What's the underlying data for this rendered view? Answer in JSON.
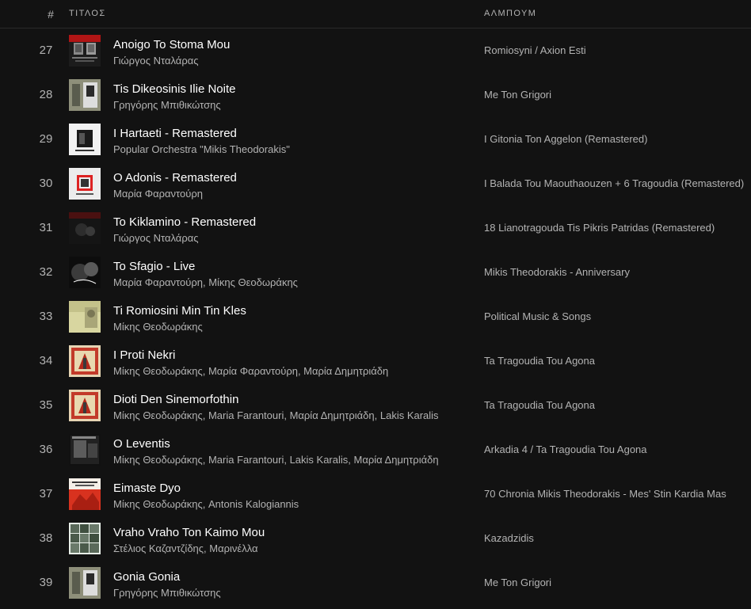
{
  "header": {
    "num": "#",
    "title": "ΤΙΤΛΟΣ",
    "album": "ΑΛΜΠΟΥΜ"
  },
  "tracks": [
    {
      "num": "27",
      "title": "Anoigo To Stoma Mou",
      "artist": "Γιώργος Νταλάρας",
      "album": "Romiosyni / Axion Esti",
      "cover_style": "romiosyni"
    },
    {
      "num": "28",
      "title": "Tis Dikeosinis Ilie Noite",
      "artist": "Γρηγόρης Μπιθικώτσης",
      "album": "Me Ton Grigori",
      "cover_style": "grigori"
    },
    {
      "num": "29",
      "title": "I Hartaeti - Remastered",
      "artist": "Popular Orchestra \"Mikis Theodorakis\"",
      "album": "I Gitonia Ton Aggelon (Remastered)",
      "cover_style": "gitonia"
    },
    {
      "num": "30",
      "title": "O Adonis - Remastered",
      "artist": "Μαρία Φαραντούρη",
      "album": "I Balada Tou Maouthaouzen + 6 Tragoudia (Remastered)",
      "cover_style": "balada"
    },
    {
      "num": "31",
      "title": "To Kiklamino - Remastered",
      "artist": "Γιώργος Νταλάρας",
      "album": "18 Lianotragouda Tis Pikris Patridas (Remastered)",
      "cover_style": "lianotragouda"
    },
    {
      "num": "32",
      "title": "To Sfagio - Live",
      "artist": "Μαρία Φαραντούρη, Μίκης Θεοδωράκης",
      "album": "Mikis Theodorakis - Anniversary",
      "cover_style": "anniversary"
    },
    {
      "num": "33",
      "title": "Ti Romiosini Min Tin Kles",
      "artist": "Μίκης Θεοδωράκης",
      "album": "Political Music & Songs",
      "cover_style": "political"
    },
    {
      "num": "34",
      "title": "I Proti Nekri",
      "artist": "Μίκης Θεοδωράκης, Μαρία Φαραντούρη, Μαρία Δημητριάδη",
      "album": "Ta Tragoudia Tou Agona",
      "cover_style": "agona"
    },
    {
      "num": "35",
      "title": "Dioti Den Sinemorfothin",
      "artist": "Μίκης Θεοδωράκης, Maria Farantouri, Μαρία Δημητριάδη, Lakis Karalis",
      "album": "Ta Tragoudia Tou Agona",
      "cover_style": "agona"
    },
    {
      "num": "36",
      "title": "O Leventis",
      "artist": "Μίκης Θεοδωράκης, Maria Farantouri, Lakis Karalis, Μαρία Δημητριάδη",
      "album": "Arkadia 4 / Ta Tragoudia Tou Agona",
      "cover_style": "arkadia"
    },
    {
      "num": "37",
      "title": "Eimaste Dyo",
      "artist": "Μίκης Θεοδωράκης, Antonis Kalogiannis",
      "album": "70 Chronia Mikis Theodorakis - Mes' Stin Kardia Mas",
      "cover_style": "chronia"
    },
    {
      "num": "38",
      "title": "Vraho Vraho Ton Kaimo Mou",
      "artist": "Στέλιος Καζαντζίδης, Μαρινέλλα",
      "album": "Kazadzidis",
      "cover_style": "kazadzidis"
    },
    {
      "num": "39",
      "title": "Gonia Gonia",
      "artist": "Γρηγόρης Μπιθικώτσης",
      "album": "Me Ton Grigori",
      "cover_style": "grigori"
    }
  ]
}
